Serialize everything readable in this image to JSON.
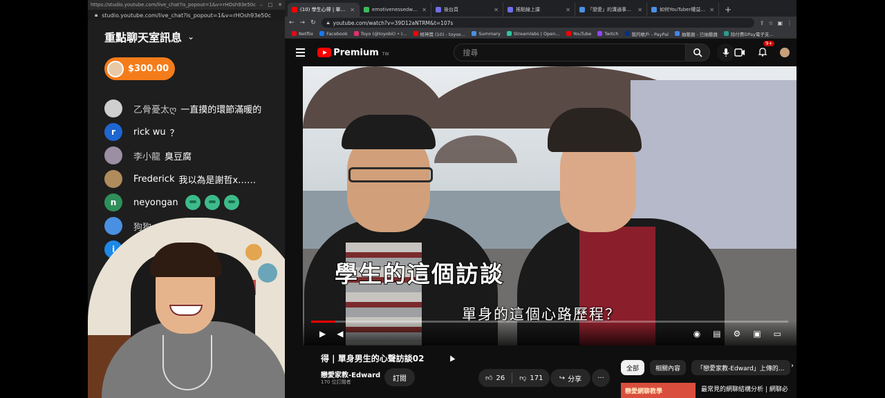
{
  "chat_window": {
    "titlebar_url": "https://studio.youtube.com/live_chat?is_popout=1&v=rHOsh93e50c",
    "address": "studio.youtube.com/live_chat?is_popout=1&v=rHOsh93e50c",
    "header": "重點聊天室訊息",
    "superchat_amount": "$300.00",
    "messages": [
      {
        "author": "乙骨憂太ღ",
        "text": "一直摸的環節滿暖的",
        "avatar_color": "#cfcfcf",
        "initial": ""
      },
      {
        "author": "rick wu",
        "text": "？",
        "avatar_color": "#1e66d0",
        "initial": "r"
      },
      {
        "author": "李小龍",
        "text": "臭豆腐",
        "avatar_color": "#9a8fa3",
        "initial": ""
      },
      {
        "author": "Frederick",
        "text": "我以為是謝哲x……",
        "avatar_color": "#b08b5c",
        "initial": ""
      },
      {
        "author": "neyongan",
        "text": "",
        "avatar_color": "#2f8f5b",
        "initial": "n"
      },
      {
        "author": "狗狗",
        "text": "",
        "avatar_color": "#4a90e2",
        "initial": ""
      },
      {
        "author": "",
        "text": "",
        "avatar_color": "#1e88e5",
        "initial": "i"
      }
    ]
  },
  "browser": {
    "tabs": [
      {
        "label": "(10) 學生心得 | 單身…",
        "color": "#ff0000"
      },
      {
        "label": "emotivenessedward | N…",
        "color": "#3dbb5b"
      },
      {
        "label": "後台頁",
        "color": "#6f6fe8"
      },
      {
        "label": "搖點線上課",
        "color": "#6f6fe8"
      },
      {
        "label": "「戀愛」的溝通事件 | D…",
        "color": "#4a90e2"
      },
      {
        "label": "如何YouTuber權益轉移",
        "color": "#4a90e2"
      }
    ],
    "new_tab": "+",
    "address": "youtube.com/watch?v=39D12aNTRM&t=107s",
    "bookmarks": [
      {
        "label": "Netflix",
        "color": "#e50914"
      },
      {
        "label": "Facebook",
        "color": "#1877f2"
      },
      {
        "label": "Toyo (@toyobii) • I…",
        "color": "#e1306c"
      },
      {
        "label": "極神獎 (10) - toyox…",
        "color": "#ff0000"
      },
      {
        "label": "Summary",
        "color": "#4a90e2"
      },
      {
        "label": "Streamlabs | Open…",
        "color": "#31c3a2"
      },
      {
        "label": "YouTube",
        "color": "#ff0000"
      },
      {
        "label": "Twitch",
        "color": "#9146ff"
      },
      {
        "label": "我的帳戶 - PayPal",
        "color": "#003087"
      },
      {
        "label": "抽籤器 - 已抽籤器",
        "color": "#4285f4"
      },
      {
        "label": "除付費DPay電子支…",
        "color": "#2a9d8f"
      }
    ]
  },
  "youtube": {
    "brand": "Premium",
    "brand_sup": "TW",
    "search_placeholder": "搜尋",
    "notification_count": "9+",
    "subtitle_line": "單身的這個心路歷程？",
    "caption_big": "學生的這個訪談",
    "progress": 0.05,
    "video_title": "得 | 單身男生的心聲訪談02",
    "channel_name": "戀愛家教-Edward",
    "subscribers": "170 位訂閱者",
    "subscribe_label": "訂閱",
    "likes": "26",
    "dislikes": "171",
    "share_label": "分享",
    "more_label": "···",
    "chips": [
      "全部",
      "相關內容",
      "「戀愛家教-Edward」上傳的…"
    ],
    "rec_thumb_text": "戀愛網聊教學",
    "rec_title": "最常見的網聊結構分析 | 網聊必"
  }
}
